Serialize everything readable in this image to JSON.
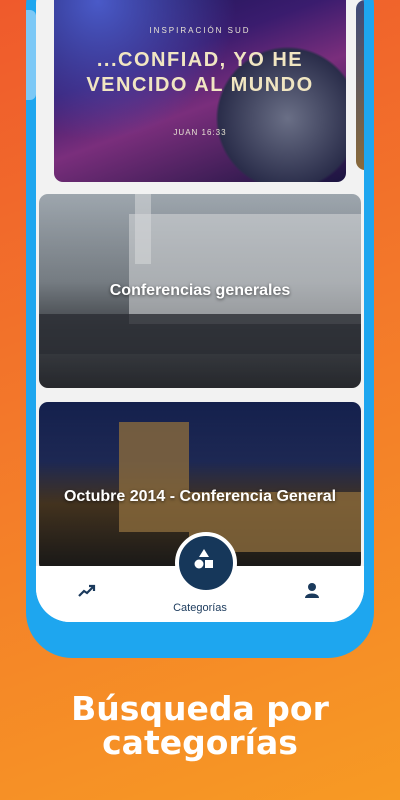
{
  "hero": {
    "brand": "INSPIRACIÓN SUD",
    "quote": "...CONFIAD, YO HE VENCIDO AL MUNDO",
    "reference": "JUAN 16:33"
  },
  "cards": [
    {
      "title": "Conferencias generales"
    },
    {
      "title": "Octubre 2014 - Conferencia General"
    }
  ],
  "nav": {
    "trending_icon": "trending-up-icon",
    "categories_icon": "shapes-icon",
    "categories_label": "Categorías",
    "profile_icon": "person-icon"
  },
  "caption": {
    "line1": "Búsqueda por",
    "line2": "categorías"
  },
  "colors": {
    "background_top": "#ef5a2c",
    "background_bottom": "#f79a24",
    "phone_frame": "#1ea6ef",
    "nav_accent": "#16375a"
  }
}
